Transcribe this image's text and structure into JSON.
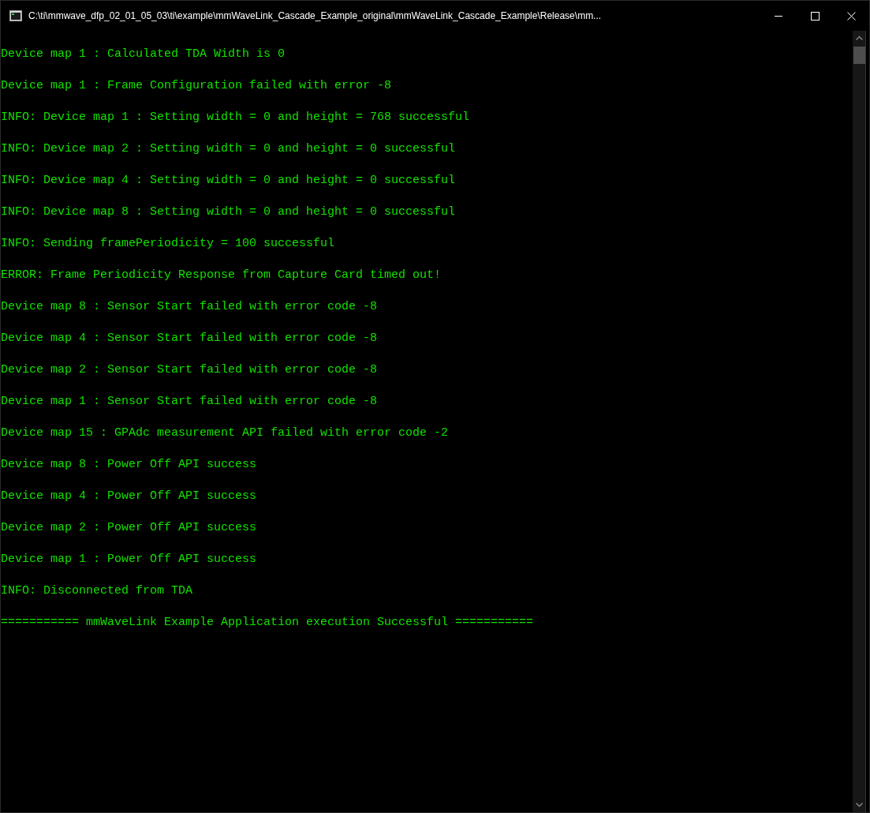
{
  "window": {
    "title": "C:\\ti\\mmwave_dfp_02_01_05_03\\ti\\example\\mmWaveLink_Cascade_Example_original\\mmWaveLink_Cascade_Example\\Release\\mm..."
  },
  "console": {
    "lines": [
      "Device map 1 : Calculated TDA Width is 0",
      "Device map 1 : Frame Configuration failed with error -8",
      "INFO: Device map 1 : Setting width = 0 and height = 768 successful",
      "INFO: Device map 2 : Setting width = 0 and height = 0 successful",
      "INFO: Device map 4 : Setting width = 0 and height = 0 successful",
      "INFO: Device map 8 : Setting width = 0 and height = 0 successful",
      "INFO: Sending framePeriodicity = 100 successful",
      "ERROR: Frame Periodicity Response from Capture Card timed out!",
      "Device map 8 : Sensor Start failed with error code -8",
      "Device map 4 : Sensor Start failed with error code -8",
      "Device map 2 : Sensor Start failed with error code -8",
      "Device map 1 : Sensor Start failed with error code -8",
      "Device map 15 : GPAdc measurement API failed with error code -2",
      "Device map 8 : Power Off API success",
      "Device map 4 : Power Off API success",
      "Device map 2 : Power Off API success",
      "Device map 1 : Power Off API success",
      "INFO: Disconnected from TDA",
      "=========== mmWaveLink Example Application execution Successful ==========="
    ]
  }
}
